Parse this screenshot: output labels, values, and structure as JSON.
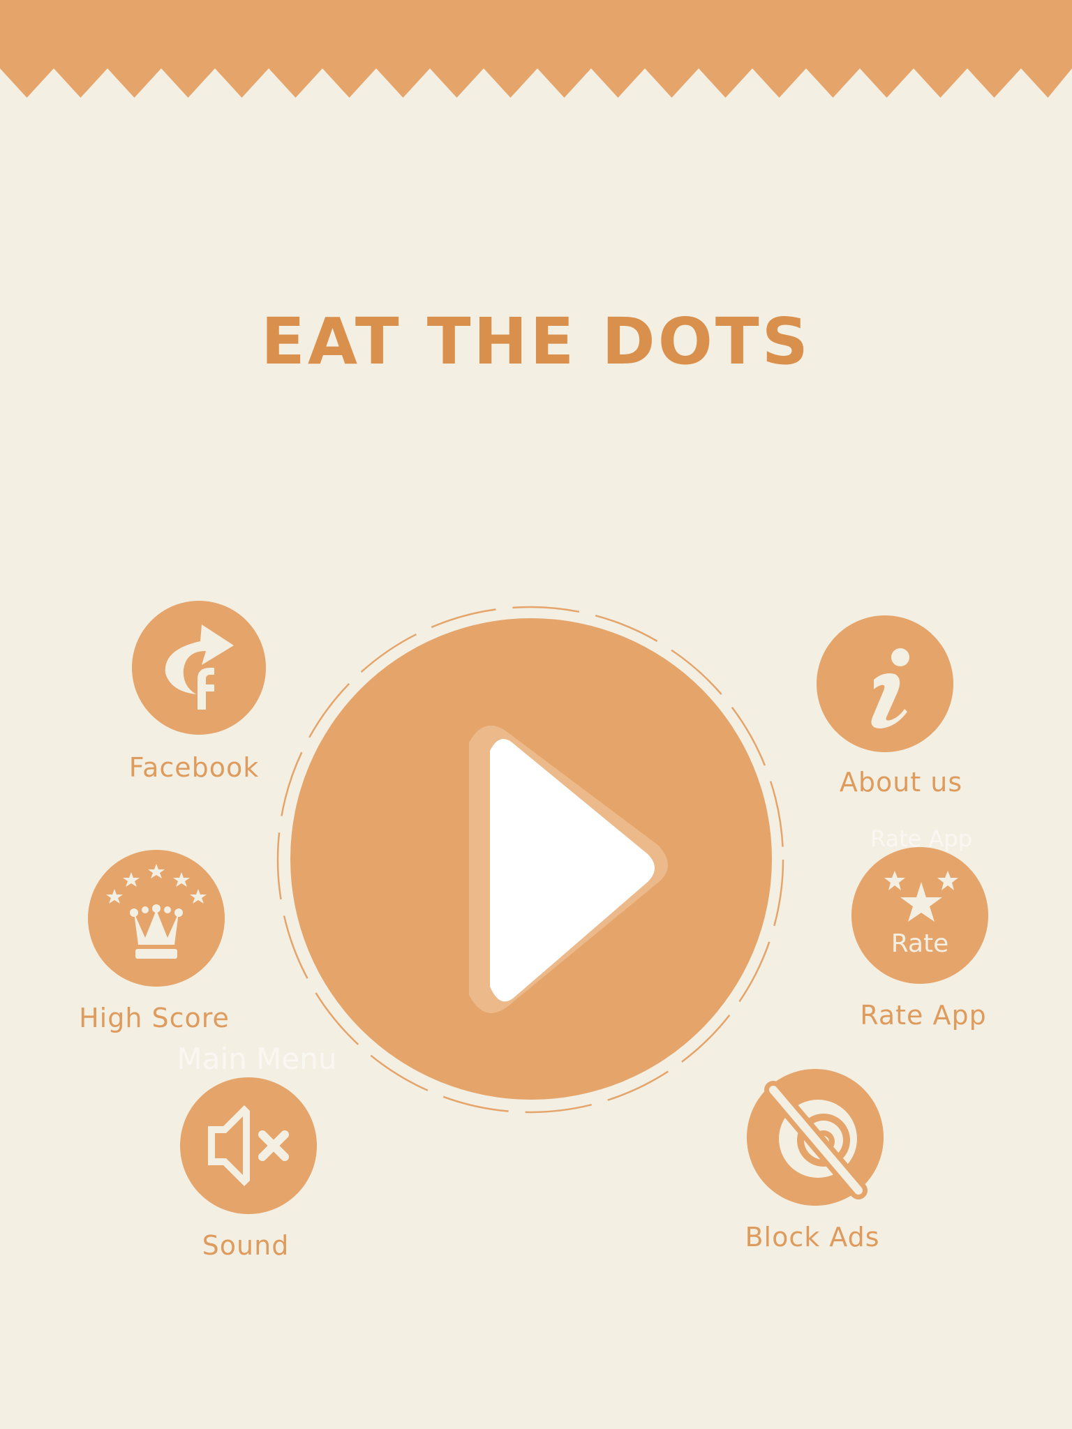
{
  "theme": {
    "background": "#F4EFE3",
    "accent": "#E4A46A",
    "text": "#DE9B5E",
    "title": "#D9904D",
    "icon": "#F4EFE3",
    "play_glyph": "#FFFFFF"
  },
  "title": "EAT THE DOTS",
  "play": {
    "icon": "play-icon"
  },
  "buttons": {
    "facebook": {
      "label": "Facebook",
      "icon": "facebook-share-icon"
    },
    "high_score": {
      "label": "High Score",
      "icon": "crown-stars-icon"
    },
    "sound": {
      "label": "Sound",
      "icon": "speaker-muted-icon"
    },
    "about": {
      "label": "About us",
      "icon": "info-icon"
    },
    "rate": {
      "label": "Rate App",
      "inner_text": "Rate",
      "icon": "star-rate-icon"
    },
    "block_ads": {
      "label": "Block Ads",
      "icon": "no-ads-icon"
    }
  },
  "ghost_labels": {
    "rate_app": "Rate App",
    "main_menu": "Main Menu"
  }
}
